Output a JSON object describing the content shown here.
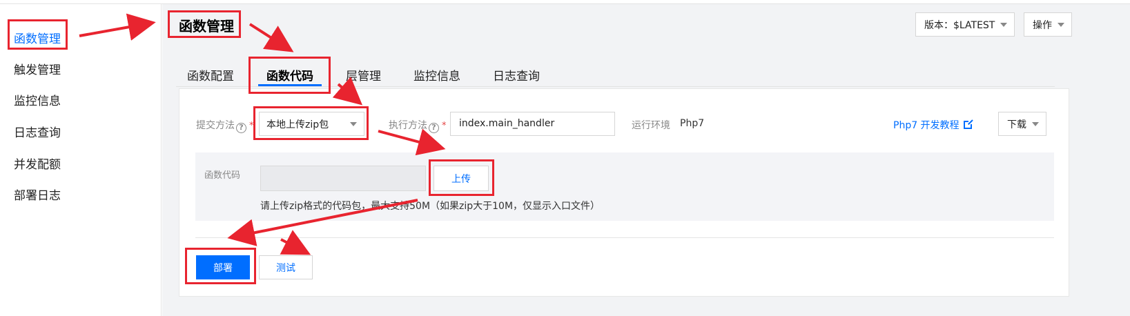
{
  "sidebar": {
    "items": [
      {
        "label": "函数管理",
        "active": true
      },
      {
        "label": "触发管理"
      },
      {
        "label": "监控信息"
      },
      {
        "label": "日志查询"
      },
      {
        "label": "并发配额"
      },
      {
        "label": "部署日志"
      }
    ]
  },
  "header": {
    "title": "函数管理",
    "version_label": "版本：$LATEST",
    "ops_label": "操作"
  },
  "tabs": [
    {
      "label": "函数配置"
    },
    {
      "label": "函数代码",
      "active": true
    },
    {
      "label": "层管理"
    },
    {
      "label": "监控信息"
    },
    {
      "label": "日志查询"
    }
  ],
  "form": {
    "submit_method_label": "提交方法",
    "submit_method_value": "本地上传zip包",
    "exec_method_label": "执行方法",
    "exec_method_value": "index.main_handler",
    "runtime_label": "运行环境",
    "runtime_value": "Php7",
    "tutorial_link": "Php7 开发教程",
    "download_label": "下载",
    "required_mark": "*",
    "help_glyph": "?"
  },
  "upload": {
    "code_label": "函数代码",
    "upload_button": "上传",
    "hint": "请上传zip格式的代码包，最大支持50M（如果zip大于10M，仅显示入口文件）"
  },
  "actions": {
    "deploy_button": "部署",
    "test_button": "测试"
  },
  "colors": {
    "accent": "#006eff",
    "annotation": "#e8242f"
  }
}
